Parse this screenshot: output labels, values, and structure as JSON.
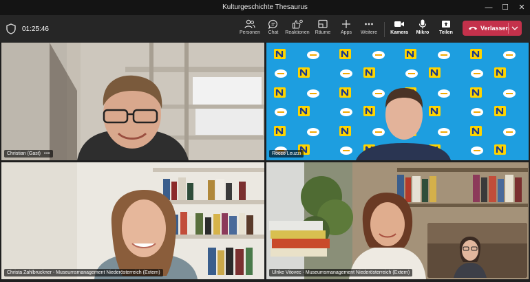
{
  "window": {
    "title": "Kulturgeschichte Thesaurus",
    "min": "—",
    "max": "☐",
    "close": "✕"
  },
  "meeting": {
    "timer": "01:25:46",
    "buttons": [
      {
        "key": "people",
        "label": "Personen",
        "icon": "people-icon"
      },
      {
        "key": "chat",
        "label": "Chat",
        "icon": "chat-icon"
      },
      {
        "key": "reactions",
        "label": "Reaktionen",
        "icon": "reactions-icon"
      },
      {
        "key": "rooms",
        "label": "Räume",
        "icon": "rooms-icon"
      },
      {
        "key": "apps",
        "label": "Apps",
        "icon": "plus-icon"
      },
      {
        "key": "more",
        "label": "Weitere",
        "icon": "more-icon"
      },
      {
        "key": "camera",
        "label": "Kamera",
        "icon": "camera-icon"
      },
      {
        "key": "mic",
        "label": "Mikro",
        "icon": "mic-icon"
      },
      {
        "key": "share",
        "label": "Teilen",
        "icon": "share-icon"
      }
    ],
    "leave_label": "Verlassen",
    "accent": "#c4314b",
    "speaking_color": "#8f8ff0"
  },
  "participants": [
    {
      "name": "Christian (Gast)",
      "more": "•••"
    },
    {
      "name": "Rocco Leuzzi"
    },
    {
      "name": "Christa Zahlbruckner - Museumsmanagement Niederösterreich (Extern)"
    },
    {
      "name": "Ulrike Vitovec - Museumsmanagement Niederösterreich (Extern)"
    }
  ]
}
